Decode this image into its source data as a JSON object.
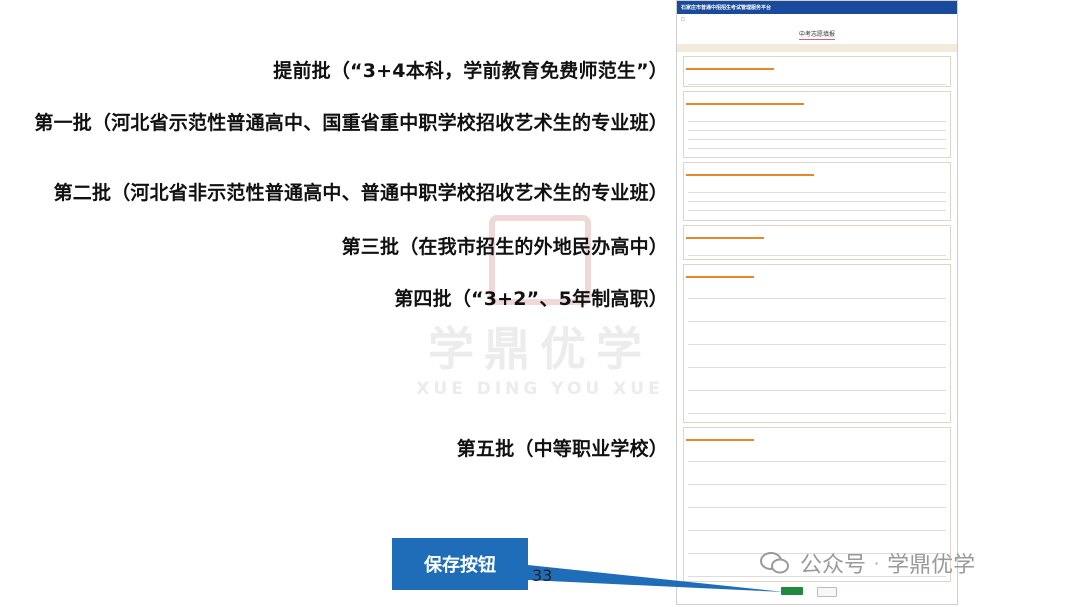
{
  "slide": {
    "batch_labels": [
      "提前批（“3+4本科，学前教育免费师范生”）",
      "第一批（河北省示范性普通高中、国重省重中职学校招收艺术生的专业班）",
      "第二批（河北省非示范性普通高中、普通中职学校招收艺术生的专业班）",
      "第三批（在我市招生的外地民办高中）",
      "第四批（“3+2”、5年制高职）",
      "第五批（中等职业学校）"
    ],
    "save_callout": "保存按钮",
    "page_number": "33",
    "watermark": {
      "text": "学鼎优学",
      "pinyin": "XUE DING YOU XUE"
    },
    "wechat": {
      "label": "公众号",
      "separator": "·",
      "account": "学鼎优学"
    }
  },
  "form": {
    "header_title": "石家庄市普通中招招生考试管理服务平台",
    "form_title": "中考志愿填报",
    "colors": {
      "header": "#1a4a9a",
      "section_tag": "#e3882b",
      "save_button": "#1f8a3b",
      "callout": "#1f6db8"
    }
  }
}
